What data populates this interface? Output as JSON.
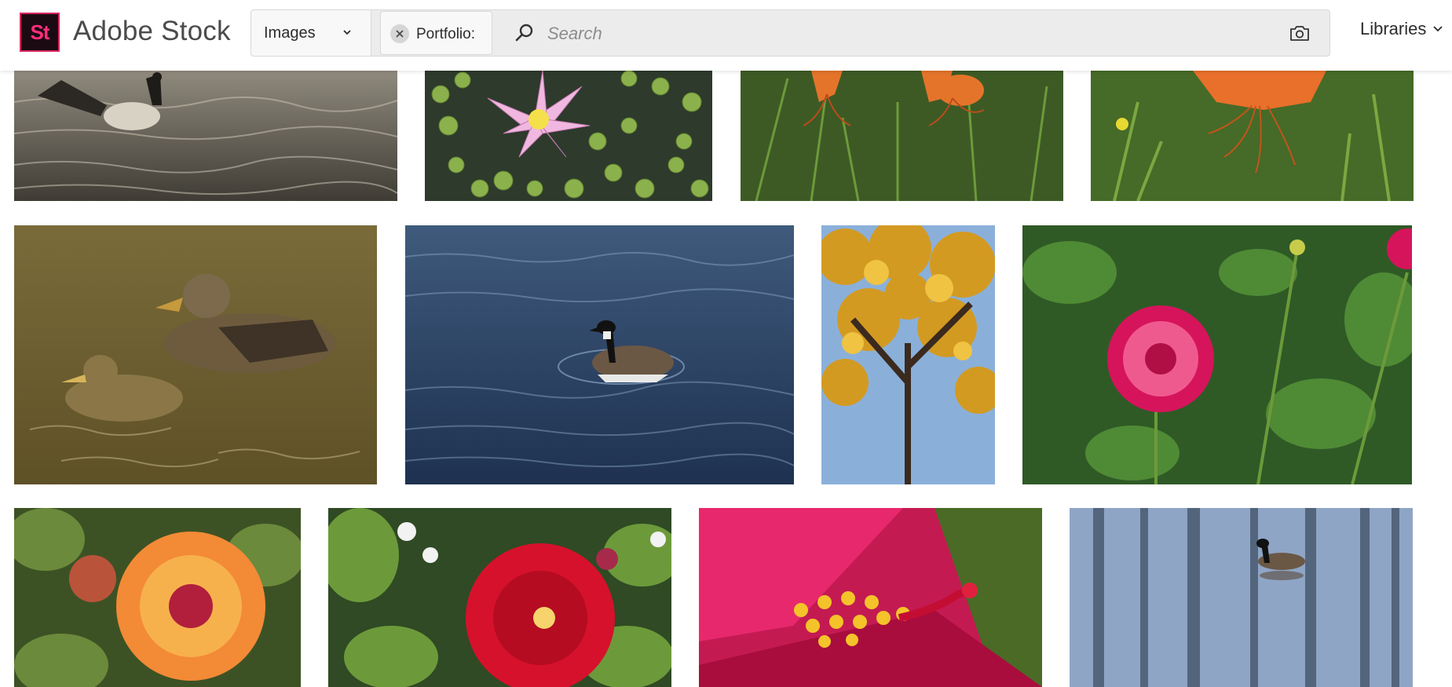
{
  "brand": {
    "logo_mark": "St",
    "name": "Adobe Stock"
  },
  "search": {
    "type_selected": "Images",
    "filter_chip": "Portfolio:",
    "placeholder": "Search"
  },
  "nav": {
    "libraries": "Libraries"
  },
  "icons": [
    "chevron-down-icon",
    "close-icon",
    "search-icon",
    "camera-icon"
  ],
  "colors": {
    "brand_pink": "#ff2e7a",
    "logo_bg": "#1c0a12",
    "searchbar_bg": "#ececec"
  },
  "gallery": [
    {
      "row": 1,
      "subject": "goose flapping wings, sepia water"
    },
    {
      "row": 1,
      "subject": "pink water lily among lily pads"
    },
    {
      "row": 1,
      "subject": "orange tiger lilies"
    },
    {
      "row": 1,
      "subject": "orange tiger lily close-up"
    },
    {
      "row": 2,
      "subject": "mallard duck with duckling"
    },
    {
      "row": 2,
      "subject": "canada goose on blue lake"
    },
    {
      "row": 2,
      "subject": "autumn tree with yellow leaves"
    },
    {
      "row": 2,
      "subject": "pink dahlia in garden"
    },
    {
      "row": 3,
      "subject": "orange dahlia"
    },
    {
      "row": 3,
      "subject": "red hibiscus flower"
    },
    {
      "row": 3,
      "subject": "hibiscus stamen macro"
    },
    {
      "row": 3,
      "subject": "goose on reflective water"
    }
  ]
}
